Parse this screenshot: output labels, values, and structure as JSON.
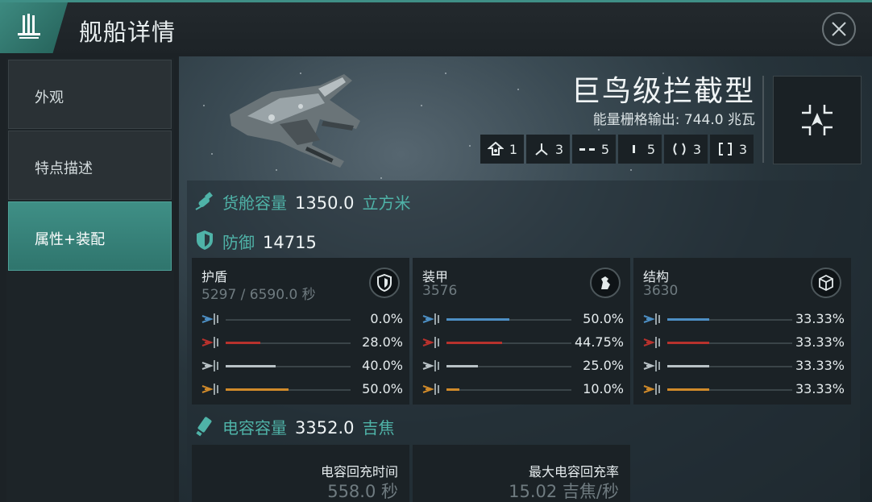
{
  "header": {
    "title": "舰船详情"
  },
  "sidebar": {
    "items": [
      {
        "label": "外观",
        "active": false
      },
      {
        "label": "特点描述",
        "active": false
      },
      {
        "label": "属性+装配",
        "active": true
      }
    ]
  },
  "ship": {
    "name": "巨鸟级拦截型",
    "power_output": "能量栅格输出: 744.0 兆瓦",
    "slots": [
      {
        "icon": "drone-icon",
        "count": "1"
      },
      {
        "icon": "turret-icon",
        "count": "3"
      },
      {
        "icon": "high-slot-icon",
        "count": "5"
      },
      {
        "icon": "mid-slot-icon",
        "count": "5"
      },
      {
        "icon": "low-slot-icon",
        "count": "3"
      },
      {
        "icon": "rig-slot-icon",
        "count": "3"
      }
    ]
  },
  "cargo": {
    "label": "货舱容量",
    "value": "1350.0",
    "unit": "立方米"
  },
  "defense": {
    "label": "防御",
    "value": "14715"
  },
  "resistances": [
    {
      "title": "护盾",
      "sub": "5297 / 6590.0 秒",
      "emblem": "shield-emblem-icon",
      "rows": [
        {
          "type": "em",
          "pct": "0.0%",
          "fraction": 0.0,
          "color": "#4d8fc4"
        },
        {
          "type": "thermal",
          "pct": "28.0%",
          "fraction": 0.28,
          "color": "#b8322d"
        },
        {
          "type": "kinetic",
          "pct": "40.0%",
          "fraction": 0.4,
          "color": "#b9c2c6"
        },
        {
          "type": "explosive",
          "pct": "50.0%",
          "fraction": 0.5,
          "color": "#d08a2a"
        }
      ]
    },
    {
      "title": "装甲",
      "sub": "3576",
      "emblem": "armor-emblem-icon",
      "rows": [
        {
          "type": "em",
          "pct": "50.0%",
          "fraction": 0.5,
          "color": "#4d8fc4"
        },
        {
          "type": "thermal",
          "pct": "44.75%",
          "fraction": 0.4475,
          "color": "#b8322d"
        },
        {
          "type": "kinetic",
          "pct": "25.0%",
          "fraction": 0.25,
          "color": "#b9c2c6"
        },
        {
          "type": "explosive",
          "pct": "10.0%",
          "fraction": 0.1,
          "color": "#d08a2a"
        }
      ]
    },
    {
      "title": "结构",
      "sub": "3630",
      "emblem": "structure-emblem-icon",
      "rows": [
        {
          "type": "em",
          "pct": "33.33%",
          "fraction": 0.3333,
          "color": "#4d8fc4"
        },
        {
          "type": "thermal",
          "pct": "33.33%",
          "fraction": 0.3333,
          "color": "#b8322d"
        },
        {
          "type": "kinetic",
          "pct": "33.33%",
          "fraction": 0.3333,
          "color": "#b9c2c6"
        },
        {
          "type": "explosive",
          "pct": "33.33%",
          "fraction": 0.3333,
          "color": "#d08a2a"
        }
      ]
    }
  ],
  "capacitor": {
    "label": "电容容量",
    "value": "3352.0",
    "unit": "吉焦",
    "recharge_time_label": "电容回充时间",
    "recharge_time": "558.0 秒",
    "max_rate_label": "最大电容回充率",
    "max_rate": "15.02 吉焦/秒"
  }
}
